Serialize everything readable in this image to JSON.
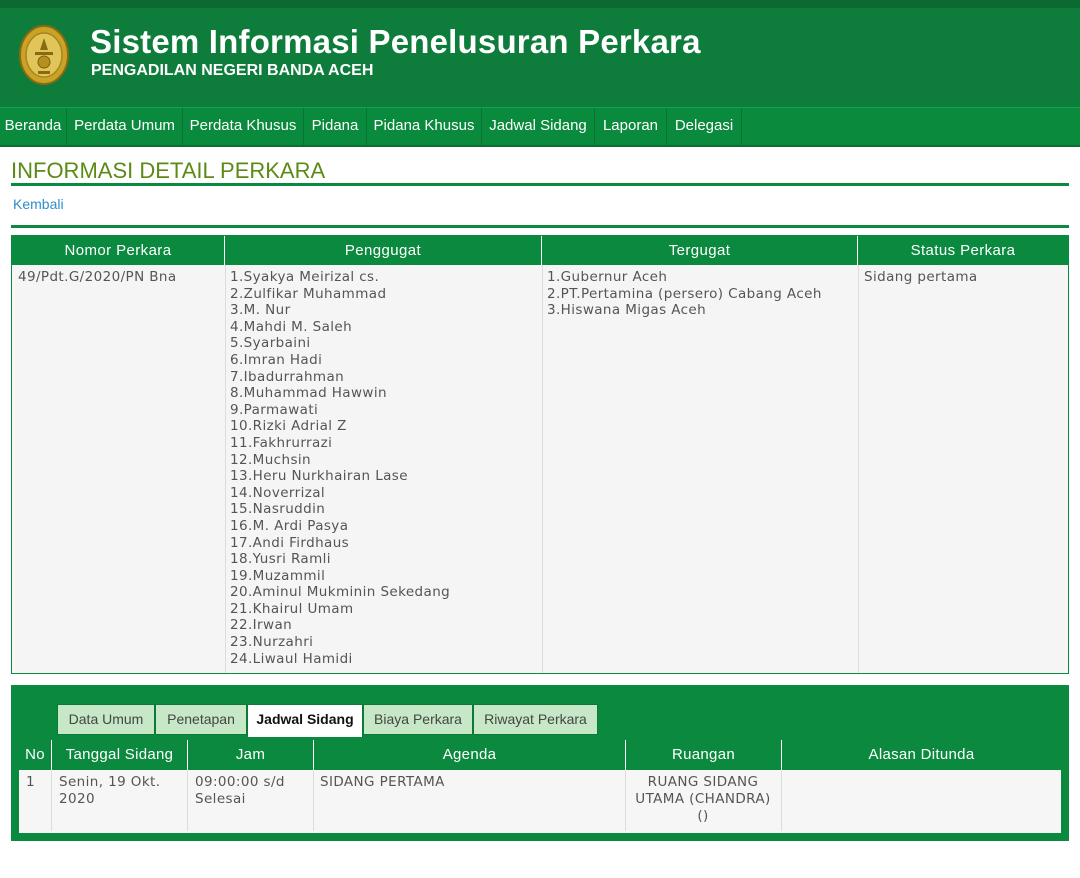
{
  "header": {
    "title": "Sistem Informasi Penelusuran Perkara",
    "subtitle": "PENGADILAN NEGERI BANDA ACEH",
    "logo_icon": "court-emblem-logo"
  },
  "nav": [
    "Beranda",
    "Perdata Umum",
    "Perdata Khusus",
    "Pidana",
    "Pidana Khusus",
    "Jadwal Sidang",
    "Laporan",
    "Delegasi"
  ],
  "page": {
    "title": "INFORMASI DETAIL PERKARA",
    "back_link": "Kembali"
  },
  "case_table": {
    "headers": [
      "Nomor Perkara",
      "Penggugat",
      "Tergugat",
      "Status Perkara"
    ],
    "nomor_perkara": "49/Pdt.G/2020/PN Bna",
    "penggugat": [
      "1.Syakya Meirizal cs.",
      "2.Zulfikar Muhammad",
      "3.M. Nur",
      "4.Mahdi M. Saleh",
      "5.Syarbaini",
      "6.Imran Hadi",
      "7.Ibadurrahman",
      "8.Muhammad Hawwin",
      "9.Parmawati",
      "10.Rizki Adrial Z",
      "11.Fakhrurrazi",
      "12.Muchsin",
      "13.Heru Nurkhairan Lase",
      "14.Noverrizal",
      "15.Nasruddin",
      "16.M. Ardi Pasya",
      "17.Andi Firdhaus",
      "18.Yusri Ramli",
      "19.Muzammil",
      "20.Aminul Mukminin Sekedang",
      "21.Khairul Umam",
      "22.Irwan",
      "23.Nurzahri",
      "24.Liwaul Hamidi"
    ],
    "tergugat": [
      "1.Gubernur Aceh",
      "2.PT.Pertamina (persero) Cabang Aceh",
      "3.Hiswana Migas Aceh"
    ],
    "status": "Sidang pertama"
  },
  "tabs": {
    "items": [
      "Data Umum",
      "Penetapan",
      "Jadwal Sidang",
      "Biaya Perkara",
      "Riwayat Perkara"
    ],
    "active": "Jadwal Sidang"
  },
  "schedule": {
    "headers": [
      "No",
      "Tanggal Sidang",
      "Jam",
      "Agenda",
      "Ruangan",
      "Alasan Ditunda"
    ],
    "rows": [
      {
        "no": "1",
        "tanggal_1": "Senin, 19 Okt.",
        "tanggal_2": "2020",
        "jam_1": "09:00:00 s/d",
        "jam_2": "Selesai",
        "agenda": "SIDANG PERTAMA",
        "ruangan_1": "RUANG SIDANG",
        "ruangan_2": "UTAMA (CHANDRA)",
        "ruangan_3": "()",
        "alasan": ""
      }
    ]
  },
  "colors": {
    "header_bg": "#0e7c3a",
    "nav_bg": "#0a8a3c",
    "accent_green": "#0b8a3f",
    "title_green": "#5b8b16",
    "link_blue": "#2f8ec9",
    "tab_bg": "#c7e8c7"
  }
}
